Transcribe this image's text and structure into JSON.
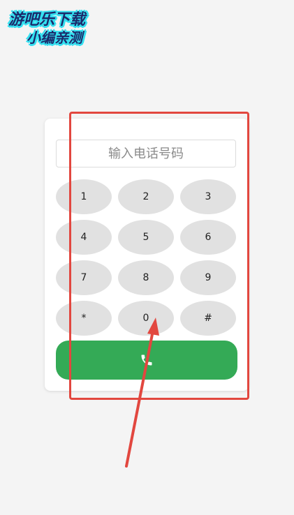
{
  "watermark": {
    "line1": "游吧乐下载",
    "line2": "小编亲测"
  },
  "dialer": {
    "placeholder": "输入电话号码",
    "keys": [
      "1",
      "2",
      "3",
      "4",
      "5",
      "6",
      "7",
      "8",
      "9",
      "*",
      "0",
      "#"
    ],
    "call_icon": "phone-icon"
  },
  "colors": {
    "call_button": "#34aa56",
    "key_background": "#e1e1e1",
    "annotation": "#e2473f",
    "page_background": "#f4f4f4"
  }
}
